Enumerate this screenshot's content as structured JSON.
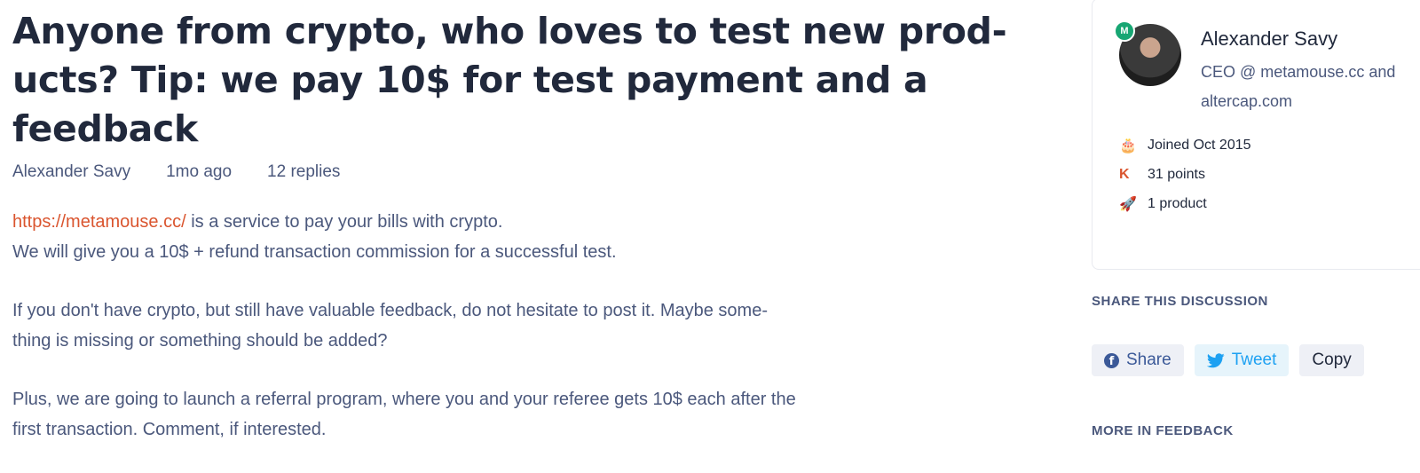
{
  "post": {
    "title_lines": [
      "Anyone from crypto, who loves to test new prod-",
      "ucts? Tip: we pay 10$ for test payment and a",
      "feedback"
    ],
    "author": "Alexander Savy",
    "time": "1mo ago",
    "replies": "12 replies",
    "link": "https://metamouse.cc/",
    "p1_rest": " is a service to pay your bills with crypto.",
    "p1_line2": "We will give you a 10$ + refund transaction commission for a successful test.",
    "p2_line1": "If you don't have crypto, but still have valuable feedback, do not hesitate to post it. Maybe some-",
    "p2_line2": "thing is missing or something should be added?",
    "p3_line1": "Plus, we are going to launch a referral program, where you and your referee gets 10$ each after the",
    "p3_line2": "first transaction. Comment, if interested."
  },
  "profile": {
    "badge": "M",
    "name": "Alexander Savy",
    "headline": "CEO @ metamouse.cc and altercap.com",
    "stats": [
      {
        "icon": "cake-icon",
        "glyph": "🎂",
        "text": "Joined Oct 2015"
      },
      {
        "icon": "karma-icon",
        "glyph": "K",
        "text": "31 points"
      },
      {
        "icon": "rocket-icon",
        "glyph": "🚀",
        "text": "1 product"
      }
    ]
  },
  "share": {
    "heading": "SHARE THIS DISCUSSION",
    "share_label": "Share",
    "tweet_label": "Tweet",
    "copy_label": "Copy"
  },
  "more": {
    "heading": "MORE IN FEEDBACK"
  },
  "colors": {
    "link": "#da552f",
    "text_dark": "#21293c",
    "text_muted": "#4b587c",
    "facebook": "#3b5998",
    "twitter": "#1da1f2"
  }
}
